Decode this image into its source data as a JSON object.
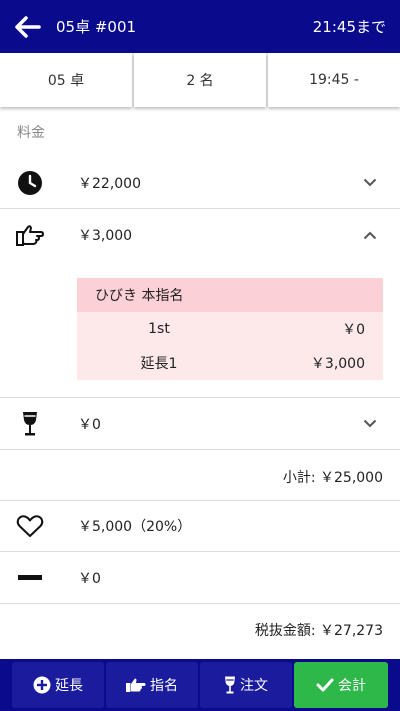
{
  "header": {
    "title": "05卓 #001",
    "until": "21:45まで"
  },
  "info": {
    "table": "05 卓",
    "guests": "2 名",
    "start": "19:45 -"
  },
  "section_label": "料金",
  "charges": [
    {
      "icon": "clock-icon",
      "amount": "￥22,000",
      "expanded": false
    },
    {
      "icon": "pointing-hand-icon",
      "amount": "￥3,000",
      "expanded": true
    },
    {
      "icon": "wine-glass-icon",
      "amount": "￥0",
      "expanded": false
    }
  ],
  "nomination": {
    "name": "ひびき 本指名",
    "lines": [
      {
        "label": "1st",
        "value": "￥0"
      },
      {
        "label": "延長1",
        "value": "￥3,000"
      }
    ]
  },
  "subtotal": "小計: ￥25,000",
  "service": {
    "icon": "heart-icon",
    "amount": "￥5,000（20%）"
  },
  "discount": {
    "icon": "minus-icon",
    "amount": "￥0"
  },
  "total": "税抜金額: ￥27,273",
  "footer": {
    "extend": "延長",
    "nominate": "指名",
    "order": "注文",
    "checkout": "会計"
  },
  "colors": {
    "primary": "#0a0a8c",
    "accent_green": "#2eb84a",
    "detail_head": "#fbd0d6",
    "detail_bg": "#fde8ea"
  }
}
